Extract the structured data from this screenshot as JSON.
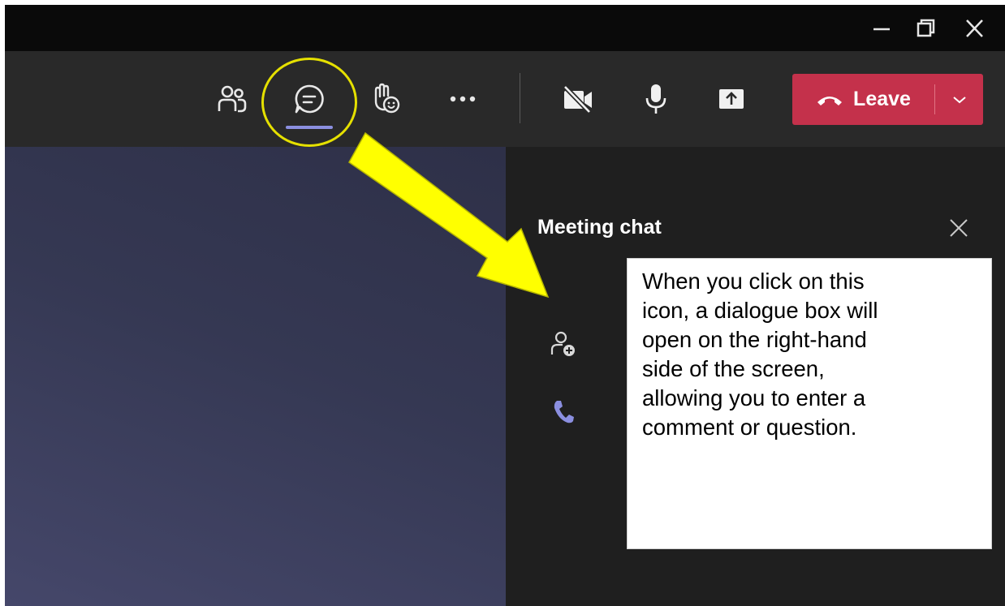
{
  "window_controls": {
    "icons": [
      "minimize-icon",
      "restore-icon",
      "close-icon"
    ]
  },
  "toolbar": {
    "people_icon": "people-icon",
    "chat_icon": "chat-icon",
    "reactions_icon": "raise-hand-reaction-icon",
    "more_icon": "more-options-icon",
    "camera_icon": "camera-off-icon",
    "mic_icon": "microphone-icon",
    "share_icon": "share-screen-icon",
    "leave_label": "Leave",
    "leave_color": "#c4314b",
    "active_indicator_color": "#8b8fe0"
  },
  "chat_panel": {
    "title": "Meeting chat",
    "side_icons": [
      "add-participant-icon",
      "phone-icon"
    ]
  },
  "annotation": {
    "callout_lines": [
      "When you click on this",
      "icon, a dialogue box will",
      "open on the right-hand",
      "side of the screen,",
      "allowing you to enter a",
      "comment or question."
    ],
    "highlight_color": "#e5e000",
    "arrow_color": "#ffff00"
  }
}
